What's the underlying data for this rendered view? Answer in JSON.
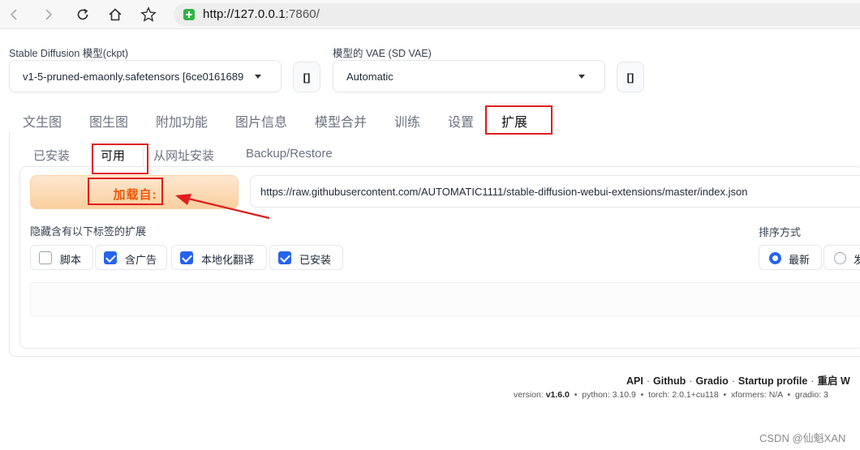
{
  "browser": {
    "url_host": "http://127.0.0.1",
    "url_rest": ":7860/"
  },
  "checkpoint": {
    "label": "Stable Diffusion 模型(ckpt)",
    "value": "v1-5-pruned-emaonly.safetensors [6ce0161689",
    "refresh_label": "[]"
  },
  "vae": {
    "label": "模型的 VAE (SD VAE)",
    "value": "Automatic",
    "refresh_label": "[]"
  },
  "main_tabs": [
    {
      "label": "文生图"
    },
    {
      "label": "图生图"
    },
    {
      "label": "附加功能"
    },
    {
      "label": "图片信息"
    },
    {
      "label": "模型合并"
    },
    {
      "label": "训练"
    },
    {
      "label": "设置"
    },
    {
      "label": "扩展",
      "active": true
    }
  ],
  "sub_tabs": [
    {
      "label": "已安装"
    },
    {
      "label": "可用",
      "active": true
    },
    {
      "label": "从网址安装"
    },
    {
      "label": "Backup/Restore"
    }
  ],
  "available": {
    "load_button": "加载自:",
    "index_url": "https://raw.githubusercontent.com/AUTOMATIC1111/stable-diffusion-webui-extensions/master/index.json",
    "hide_label": "隐藏含有以下标签的扩展",
    "hide_tags": [
      {
        "label": "脚本",
        "checked": false
      },
      {
        "label": "含广告",
        "checked": true
      },
      {
        "label": "本地化翻译",
        "checked": true
      },
      {
        "label": "已安装",
        "checked": true
      }
    ],
    "sort_label": "排序方式",
    "sort_options": [
      {
        "label": "最新",
        "selected": true
      },
      {
        "label": "发",
        "selected": false
      }
    ]
  },
  "footer": {
    "links": [
      "API",
      "Github",
      "Gradio",
      "Startup profile",
      "重启 W"
    ],
    "separator": "·",
    "version_label": "version:",
    "version": "v1.6.0",
    "python": "python: 3.10.9",
    "torch": "torch: 2.0.1+cu118",
    "xformers": "xformers: N/A",
    "gradio": "gradio: 3"
  },
  "watermark": "CSDN @仙魁XAN",
  "colors": {
    "annotation": "#e11d1d",
    "primary": "#2563eb",
    "load_button": "#fbcf9f"
  }
}
